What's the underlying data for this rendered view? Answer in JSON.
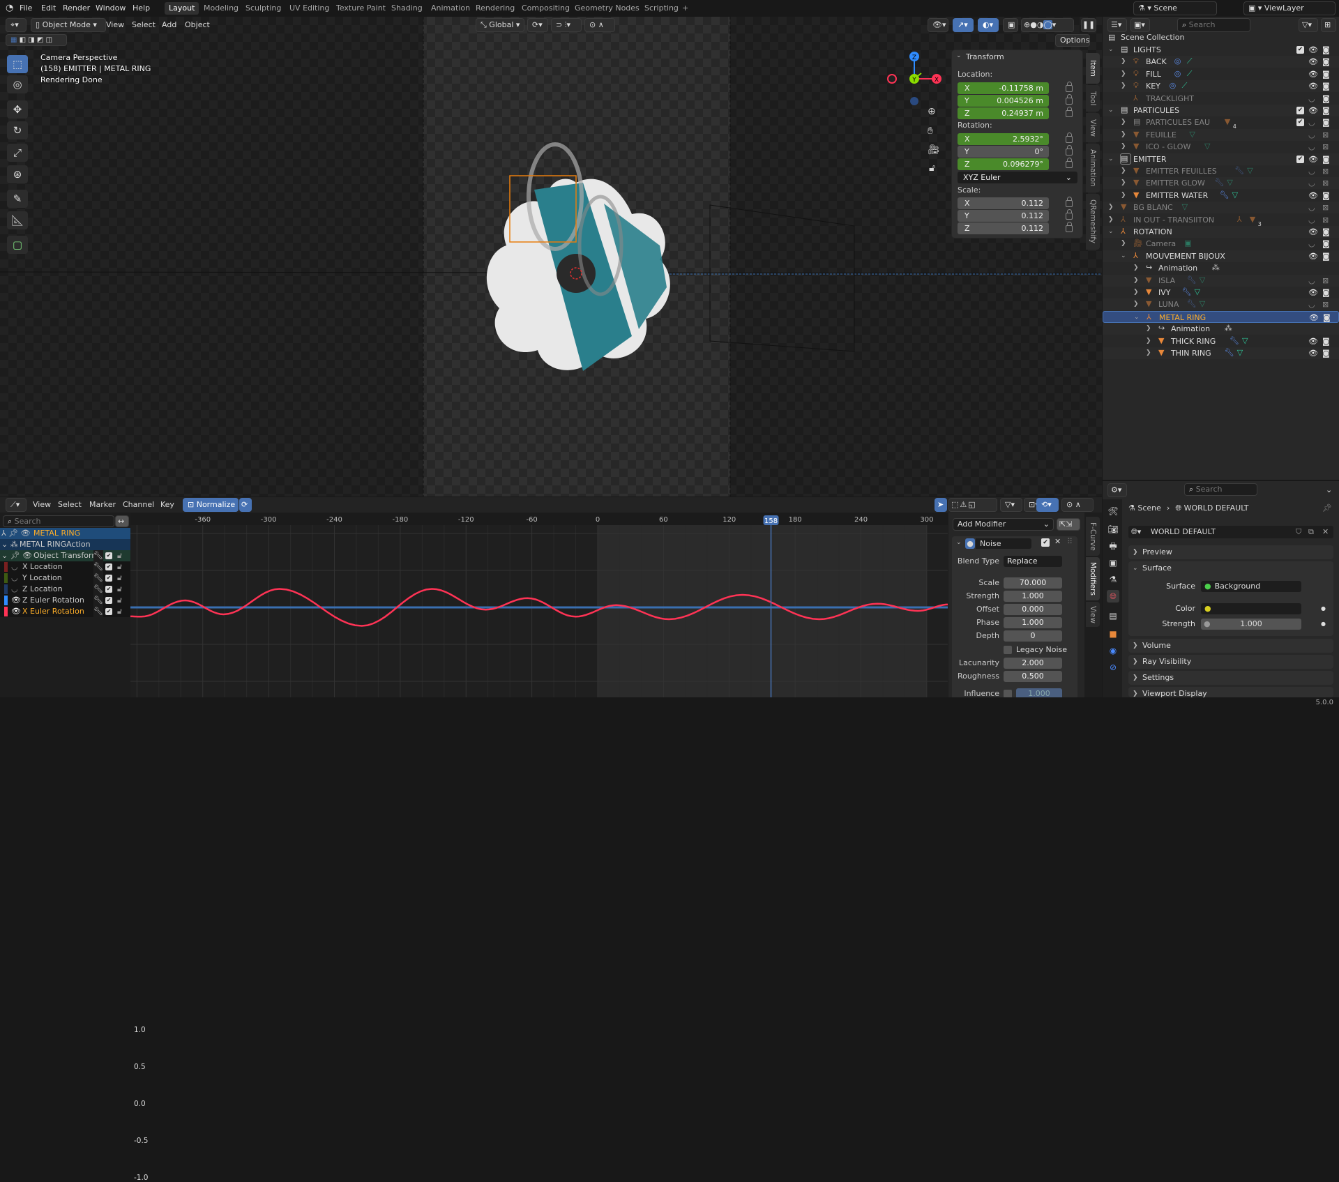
{
  "topbar": {
    "menus": [
      "File",
      "Edit",
      "Render",
      "Window",
      "Help"
    ],
    "workspaces": [
      "Layout",
      "Modeling",
      "Sculpting",
      "UV Editing",
      "Texture Paint",
      "Shading",
      "Animation",
      "Rendering",
      "Compositing",
      "Geometry Nodes",
      "Scripting"
    ],
    "active_workspace": "Layout",
    "add_workspace": "+",
    "scene": "Scene",
    "view_layer": "ViewLayer"
  },
  "viewport": {
    "mode": "Object Mode",
    "menus": [
      "View",
      "Select",
      "Add",
      "Object"
    ],
    "orientation": "Global",
    "options": "Options",
    "overlay": {
      "line1": "Camera Perspective",
      "line2": "(158) EMITTER | METAL RING",
      "line3": "Rendering Done"
    },
    "gizmo": {
      "x": "X",
      "y": "Y",
      "z": "Z"
    },
    "sidebar_tabs": [
      "Item",
      "Tool",
      "View",
      "Animation",
      "QRemeshify"
    ],
    "active_sidebar_tab": "Item",
    "tools": [
      "select-box",
      "cursor",
      "move",
      "rotate",
      "scale",
      "transform",
      "annotate",
      "measure",
      "add-cube"
    ]
  },
  "transform": {
    "title": "Transform",
    "location_label": "Location:",
    "location": [
      {
        "axis": "X",
        "value": "-0.11758 m"
      },
      {
        "axis": "Y",
        "value": "0.004526 m"
      },
      {
        "axis": "Z",
        "value": "0.24937 m"
      }
    ],
    "rotation_label": "Rotation:",
    "rotation": [
      {
        "axis": "X",
        "value": "2.5932°"
      },
      {
        "axis": "Y",
        "value": "0°"
      },
      {
        "axis": "Z",
        "value": "0.096279°"
      }
    ],
    "rotation_mode": "XYZ Euler",
    "scale_label": "Scale:",
    "scale": [
      {
        "axis": "X",
        "value": "0.112"
      },
      {
        "axis": "Y",
        "value": "0.112"
      },
      {
        "axis": "Z",
        "value": "0.112"
      }
    ]
  },
  "outliner": {
    "search_placeholder": "Search",
    "root": "Scene Collection",
    "rows": [
      {
        "name": "LIGHTS",
        "depth": 0,
        "type": "collection",
        "expanded": true,
        "check": true,
        "eye": "on",
        "render": "on"
      },
      {
        "name": "BACK",
        "depth": 1,
        "type": "light",
        "expanded": false,
        "extras": [
          "light-data",
          "constraint"
        ],
        "eye": "on",
        "render": "on"
      },
      {
        "name": "FILL",
        "depth": 1,
        "type": "light",
        "expanded": false,
        "extras": [
          "light-data",
          "constraint"
        ],
        "eye": "on",
        "render": "on"
      },
      {
        "name": "KEY",
        "depth": 1,
        "type": "light",
        "expanded": false,
        "extras": [
          "light-data",
          "constraint"
        ],
        "eye": "on",
        "render": "on"
      },
      {
        "name": "TRACKLIGHT",
        "depth": 1,
        "type": "empty",
        "dim": true,
        "eye": "off",
        "render": "on"
      },
      {
        "name": "PARTICULES",
        "depth": 0,
        "type": "collection",
        "expanded": true,
        "check": true,
        "eye": "on",
        "render": "on"
      },
      {
        "name": "PARTICULES EAU",
        "depth": 1,
        "type": "collection",
        "dim": true,
        "expanded": false,
        "extras": [
          "mesh-object"
        ],
        "badge": "4",
        "check": true,
        "eye": "off",
        "render": "on"
      },
      {
        "name": "FEUILLE",
        "depth": 1,
        "type": "mesh",
        "dim": true,
        "expanded": false,
        "extras": [
          "mesh-data"
        ],
        "eye": "off",
        "render": "disabled"
      },
      {
        "name": "ICO - GLOW",
        "depth": 1,
        "type": "mesh",
        "dim": true,
        "expanded": false,
        "extras": [
          "mesh-data"
        ],
        "eye": "off",
        "render": "disabled"
      },
      {
        "name": "EMITTER",
        "depth": 0,
        "type": "collection",
        "expanded": true,
        "active": true,
        "check": true,
        "eye": "on",
        "render": "on"
      },
      {
        "name": "EMITTER FEUILLES",
        "depth": 1,
        "type": "mesh",
        "dim": true,
        "expanded": false,
        "extras": [
          "modifier",
          "mesh-data"
        ],
        "eye": "off",
        "render": "disabled"
      },
      {
        "name": "EMITTER GLOW",
        "depth": 1,
        "type": "mesh",
        "dim": true,
        "expanded": false,
        "extras": [
          "modifier",
          "mesh-data"
        ],
        "eye": "off",
        "render": "disabled"
      },
      {
        "name": "EMITTER WATER",
        "depth": 1,
        "type": "mesh",
        "expanded": false,
        "extras": [
          "modifier",
          "mesh-data"
        ],
        "eye": "on",
        "render": "on"
      },
      {
        "name": "BG BLANC",
        "depth": 0,
        "type": "mesh",
        "dim": true,
        "expanded": false,
        "extras": [
          "mesh-data"
        ],
        "eye": "off",
        "render": "disabled"
      },
      {
        "name": "IN OUT - TRANSIITON",
        "depth": 0,
        "type": "empty",
        "dim": true,
        "expanded": false,
        "extras": [
          "empty",
          "mesh-object"
        ],
        "badge": "3",
        "eye": "off",
        "render": "disabled"
      },
      {
        "name": "ROTATION",
        "depth": 0,
        "type": "empty",
        "expanded": true,
        "eye": "on",
        "render": "on"
      },
      {
        "name": "Camera",
        "depth": 1,
        "type": "camera",
        "dim": true,
        "expanded": false,
        "extras": [
          "camera-data"
        ],
        "eye": "off",
        "render": "on"
      },
      {
        "name": "MOUVEMENT BIJOUX",
        "depth": 1,
        "type": "empty",
        "expanded": true,
        "eye": "on",
        "render": "on"
      },
      {
        "name": "Animation",
        "depth": 2,
        "type": "action",
        "expanded": false,
        "extras": [
          "action-data"
        ]
      },
      {
        "name": "ISLA",
        "depth": 2,
        "type": "mesh",
        "dim": true,
        "expanded": false,
        "extras": [
          "modifier",
          "mesh-data"
        ],
        "eye": "off",
        "render": "disabled"
      },
      {
        "name": "IVY",
        "depth": 2,
        "type": "mesh",
        "expanded": false,
        "extras": [
          "modifier",
          "mesh-data"
        ],
        "eye": "on",
        "render": "on"
      },
      {
        "name": "LUNA",
        "depth": 2,
        "type": "mesh",
        "dim": true,
        "expanded": false,
        "extras": [
          "modifier",
          "mesh-data"
        ],
        "eye": "off",
        "render": "disabled"
      },
      {
        "name": "METAL RING",
        "depth": 2,
        "type": "empty",
        "expanded": true,
        "selected": true,
        "eye": "on",
        "render": "on"
      },
      {
        "name": "Animation",
        "depth": 3,
        "type": "action",
        "expanded": false,
        "extras": [
          "action-data"
        ]
      },
      {
        "name": "THICK RING",
        "depth": 3,
        "type": "mesh",
        "expanded": false,
        "extras": [
          "modifier",
          "mesh-data"
        ],
        "eye": "on",
        "render": "on"
      },
      {
        "name": "THIN RING",
        "depth": 3,
        "type": "mesh",
        "expanded": false,
        "extras": [
          "modifier",
          "mesh-data"
        ],
        "eye": "on",
        "render": "on"
      }
    ]
  },
  "graph": {
    "menus": [
      "View",
      "Select",
      "Marker",
      "Channel",
      "Key"
    ],
    "normalize": "Normalize",
    "search_placeholder": "Search",
    "channels": [
      {
        "name": "METAL RING",
        "kind": "object"
      },
      {
        "name": "METAL RINGAction",
        "kind": "action"
      },
      {
        "name": "Object Transform",
        "kind": "group"
      },
      {
        "name": "X Location",
        "kind": "fcurve",
        "color": "#7a2020",
        "visible": false
      },
      {
        "name": "Y Location",
        "kind": "fcurve",
        "color": "#3e5a12",
        "visible": false
      },
      {
        "name": "Z Location",
        "kind": "fcurve",
        "color": "#1f3a66",
        "visible": false
      },
      {
        "name": "Z Euler Rotation",
        "kind": "fcurve",
        "color": "#2f8cff",
        "visible": true
      },
      {
        "name": "X Euler Rotation",
        "kind": "fcurve",
        "color": "#ff3355",
        "visible": true,
        "active": true
      }
    ],
    "frame_ticks": [
      -360,
      -300,
      -240,
      -180,
      -120,
      -60,
      0,
      60,
      120,
      180,
      240,
      300
    ],
    "value_ticks": [
      "1.0",
      "0.5",
      "0.0",
      "-0.5",
      "-1.0"
    ],
    "current_frame": "158",
    "scene_range": [
      0,
      300
    ],
    "x_euler_rotation_curve": [
      [
        -430,
        -0.12
      ],
      [
        -416,
        -0.125
      ],
      [
        -376,
        0.094
      ],
      [
        -341,
        -0.094
      ],
      [
        -290,
        0.25
      ],
      [
        -215,
        -0.25
      ],
      [
        -151,
        0.25
      ],
      [
        -102,
        -0.03
      ],
      [
        -64,
        0.125
      ],
      [
        -20,
        -0.125
      ],
      [
        17,
        0.03
      ],
      [
        65,
        -0.16
      ],
      [
        132,
        0.17
      ],
      [
        202,
        -0.16
      ],
      [
        255,
        0.05
      ],
      [
        292,
        -0.047
      ],
      [
        320,
        0.04
      ]
    ],
    "z_euler_rotation_value": 0.0,
    "sidebar_tabs": [
      "F-Curve",
      "Modifiers",
      "View"
    ],
    "active_sidebar_tab": "Modifiers",
    "add_modifier": "Add Modifier",
    "modifier": {
      "name": "Noise",
      "blend_type_label": "Blend Type",
      "blend_type": "Replace",
      "fields": [
        {
          "label": "Scale",
          "value": "70.000"
        },
        {
          "label": "Strength",
          "value": "1.000"
        },
        {
          "label": "Offset",
          "value": "0.000"
        },
        {
          "label": "Phase",
          "value": "1.000"
        },
        {
          "label": "Depth",
          "value": "0"
        }
      ],
      "legacy_noise": "Legacy Noise",
      "fields2": [
        {
          "label": "Lacunarity",
          "value": "2.000"
        },
        {
          "label": "Roughness",
          "value": "0.500"
        }
      ],
      "influence_label": "Influence",
      "influence": "1.000"
    }
  },
  "properties": {
    "search_placeholder": "Search",
    "breadcrumb": [
      "Scene",
      "WORLD DEFAULT"
    ],
    "world": "WORLD DEFAULT",
    "panels": {
      "preview": "Preview",
      "surface": "Surface",
      "volume": "Volume",
      "ray_visibility": "Ray Visibility",
      "settings": "Settings",
      "viewport_display": "Viewport Display"
    },
    "surface_label": "Surface",
    "surface_value": "Background",
    "color_label": "Color",
    "strength_label": "Strength",
    "strength_value": "1.000"
  },
  "status": {
    "version": "5.0.0"
  },
  "colors": {
    "accent": "#4772b3",
    "selected_text": "#ffaf29",
    "x_axis": "#ff3355",
    "y_axis": "#8bdc00",
    "z_axis": "#2f8cff",
    "green_field": "#4a8a2a"
  }
}
